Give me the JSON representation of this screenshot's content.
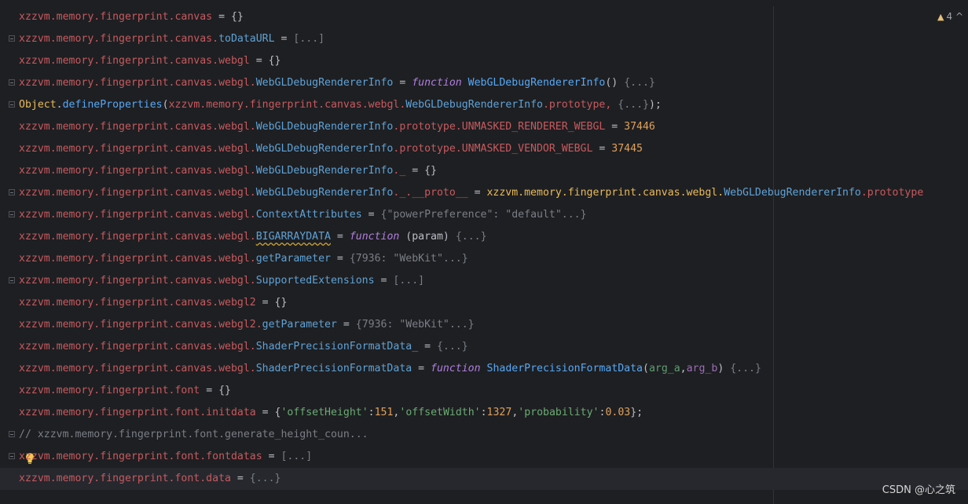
{
  "warnings": {
    "count": "4"
  },
  "watermark": "CSDN @心之筑",
  "lines": [
    {
      "l1": "xzzvm.memory.fingerprint.canvas",
      "l2": " = ",
      "l3": "{}"
    },
    {
      "l1": "xzzvm.memory.fingerprint.canvas.",
      "p": "toDataURL",
      "l2": " = ",
      "f": "[...]"
    },
    {
      "l1": "xzzvm.memory.fingerprint.canvas.webgl",
      "l2": " = ",
      "l3": "{}"
    },
    {
      "l1": "xzzvm.memory.fingerprint.canvas.webgl.",
      "p": "WebGLDebugRendererInfo",
      "l2": " = ",
      "kw": "function",
      "fn": " WebGLDebugRendererInfo",
      "a": "()",
      "f": " {...}"
    },
    {
      "obj": "Object",
      "d": ".",
      "fn": "defineProperties",
      "a": "(",
      "l1": "xzzvm.memory.fingerprint.canvas.webgl.",
      "p": "WebGLDebugRendererInfo",
      "d2": ".prototype, ",
      "f": "{...}",
      "z": ");"
    },
    {
      "l1": "xzzvm.memory.fingerprint.canvas.webgl.",
      "p": "WebGLDebugRendererInfo",
      "d2": ".prototype.UNMASKED_RENDERER_WEBGL",
      "l2": " = ",
      "n": "37446"
    },
    {
      "l1": "xzzvm.memory.fingerprint.canvas.webgl.",
      "p": "WebGLDebugRendererInfo",
      "d2": ".prototype.UNMASKED_VENDOR_WEBGL",
      "l2": " = ",
      "n": "37445"
    },
    {
      "l1": "xzzvm.memory.fingerprint.canvas.webgl.",
      "p": "WebGLDebugRendererInfo",
      "d2": "._",
      "l2": " = ",
      "l3": "{}"
    },
    {
      "l1": "xzzvm.memory.fingerprint.canvas.webgl.",
      "p": "WebGLDebugRendererInfo",
      "d2": "._.__proto__",
      "l2": " = ",
      "r1": "xzzvm.memory.fingerprint.canvas.webgl.",
      "r2": "WebGLDebugRendererInfo",
      "r3": ".prototype"
    },
    {
      "l1": "xzzvm.memory.fingerprint.canvas.webgl.",
      "p": "ContextAttributes",
      "l2": " = ",
      "f": "{\"powerPreference\": \"default\"...}"
    },
    {
      "l1": "xzzvm.memory.fingerprint.canvas.webgl.",
      "pu": "BIGARRAYDATA",
      "l2": " = ",
      "kw": "function",
      "a": " (param) ",
      "f": "{...}"
    },
    {
      "l1": "xzzvm.memory.fingerprint.canvas.webgl.",
      "p": "getParameter",
      "l2": " = ",
      "f": "{7936: \"WebKit\"...}"
    },
    {
      "l1": "xzzvm.memory.fingerprint.canvas.webgl.",
      "p": "SupportedExtensions",
      "l2": " = ",
      "f": "[...]"
    },
    {
      "l1": "xzzvm.memory.fingerprint.canvas.webgl2",
      "l2": " = ",
      "l3": "{}"
    },
    {
      "l1": "xzzvm.memory.fingerprint.canvas.webgl2.",
      "p": "getParameter",
      "l2": " = ",
      "f": "{7936: \"WebKit\"...}"
    },
    {
      "l1": "xzzvm.memory.fingerprint.canvas.webgl.",
      "p": "ShaderPrecisionFormatData_",
      "l2": " = ",
      "f": "{...}"
    },
    {
      "l1": "xzzvm.memory.fingerprint.canvas.webgl.",
      "p": "ShaderPrecisionFormatData",
      "l2": " = ",
      "kw": "function",
      "fn": " ShaderPrecisionFormatData",
      "a": "(",
      "pa": "arg_a",
      "c": ",",
      "pb": "arg_b",
      "a2": ")",
      "f": " {...}"
    },
    {
      "l1": "xzzvm.memory.fingerprint.font",
      "l2": " = ",
      "l3": "{}"
    },
    {
      "l1": "xzzvm.memory.fingerprint.font.initdata",
      "l2": " = ",
      "init": true
    },
    {
      "comment": "// xzzvm.memory.fingerprint.font.generate_height_coun..."
    },
    {
      "l1": "xzzvm.memory.fingerprint.font.fontdatas",
      "l2": " = ",
      "f": "[...]"
    },
    {
      "l1": "xzzvm.memory.fingerprint.font.data",
      "l2": " = ",
      "f": "{...}"
    }
  ],
  "initdata": {
    "open": "{",
    "k1": "'offsetHeight'",
    "v1": "151",
    "k2": "'offsetWidth'",
    "v2": "1327",
    "k3": "'probability'",
    "v3": "0.03",
    "close": "};"
  }
}
